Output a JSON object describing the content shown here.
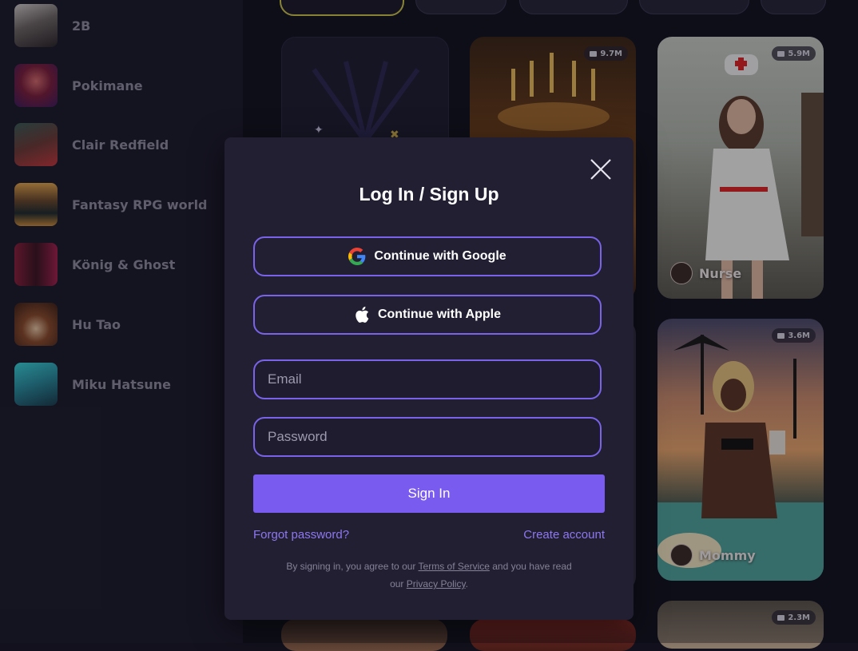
{
  "sidebar": {
    "items": [
      {
        "label": "2B"
      },
      {
        "label": "Pokimane"
      },
      {
        "label": "Clair Redfield"
      },
      {
        "label": "Fantasy RPG world"
      },
      {
        "label": "König & Ghost"
      },
      {
        "label": "Hu Tao"
      },
      {
        "label": "Miku Hatsune"
      }
    ]
  },
  "cards": [
    {
      "name": "Nurse",
      "count": "5.9M"
    },
    {
      "name": "Mommy",
      "count": "3.6M"
    },
    {
      "name": "",
      "count": "9.7M"
    },
    {
      "name": "",
      "count": "2.3M"
    }
  ],
  "modal": {
    "title": "Log In / Sign Up",
    "google_label": "Continue with Google",
    "apple_label": "Continue with Apple",
    "email_placeholder": "Email",
    "password_placeholder": "Password",
    "signin_label": "Sign In",
    "forgot_label": "Forgot password?",
    "create_label": "Create account",
    "legal_prefix": "By signing in, you agree to our",
    "terms_label": "Terms of Service",
    "legal_middle": "and you have read",
    "legal_our": "our",
    "privacy_label": "Privacy Policy",
    "legal_suffix": "."
  },
  "colors": {
    "accent": "#7a5bef",
    "border": "#7a63e8",
    "modal_bg": "#221f33",
    "page_bg": "#12111d"
  }
}
